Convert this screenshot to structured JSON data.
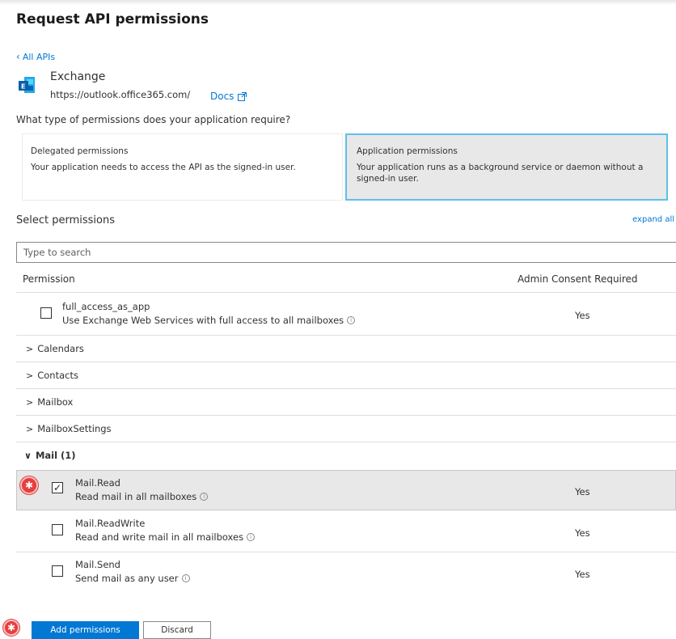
{
  "header": {
    "title": "Request API permissions"
  },
  "nav": {
    "back_label": "All APIs"
  },
  "api": {
    "name": "Exchange",
    "url": "https://outlook.office365.com/",
    "docs_label": "Docs",
    "icon": "exchange-logo"
  },
  "question": "What type of permissions does your application require?",
  "permission_types": [
    {
      "title": "Delegated permissions",
      "description": "Your application needs to access the API as the signed-in user.",
      "selected": false
    },
    {
      "title": "Application permissions",
      "description": "Your application runs as a background service or daemon without a signed-in user.",
      "selected": true
    }
  ],
  "select": {
    "label": "Select permissions",
    "expand_all": "expand all",
    "search_placeholder": "Type to search"
  },
  "table": {
    "col_permission": "Permission",
    "col_admin": "Admin Consent Required"
  },
  "top_permission": {
    "name": "full_access_as_app",
    "description": "Use Exchange Web Services with full access to all mailboxes",
    "admin_consent": "Yes",
    "checked": false
  },
  "collapsed_groups": [
    "Calendars",
    "Contacts",
    "Mailbox",
    "MailboxSettings"
  ],
  "mail_group": {
    "label": "Mail (1)",
    "permissions": [
      {
        "name": "Mail.Read",
        "description": "Read mail in all mailboxes",
        "admin_consent": "Yes",
        "checked": true
      },
      {
        "name": "Mail.ReadWrite",
        "description": "Read and write mail in all mailboxes",
        "admin_consent": "Yes",
        "checked": false
      },
      {
        "name": "Mail.Send",
        "description": "Send mail as any user",
        "admin_consent": "Yes",
        "checked": false
      }
    ]
  },
  "actions": {
    "add_label": "Add permissions",
    "discard_label": "Discard"
  },
  "colors": {
    "accent": "#0078d4",
    "selected_card_border": "#5cc0ea",
    "marker": "#e43f3f"
  }
}
